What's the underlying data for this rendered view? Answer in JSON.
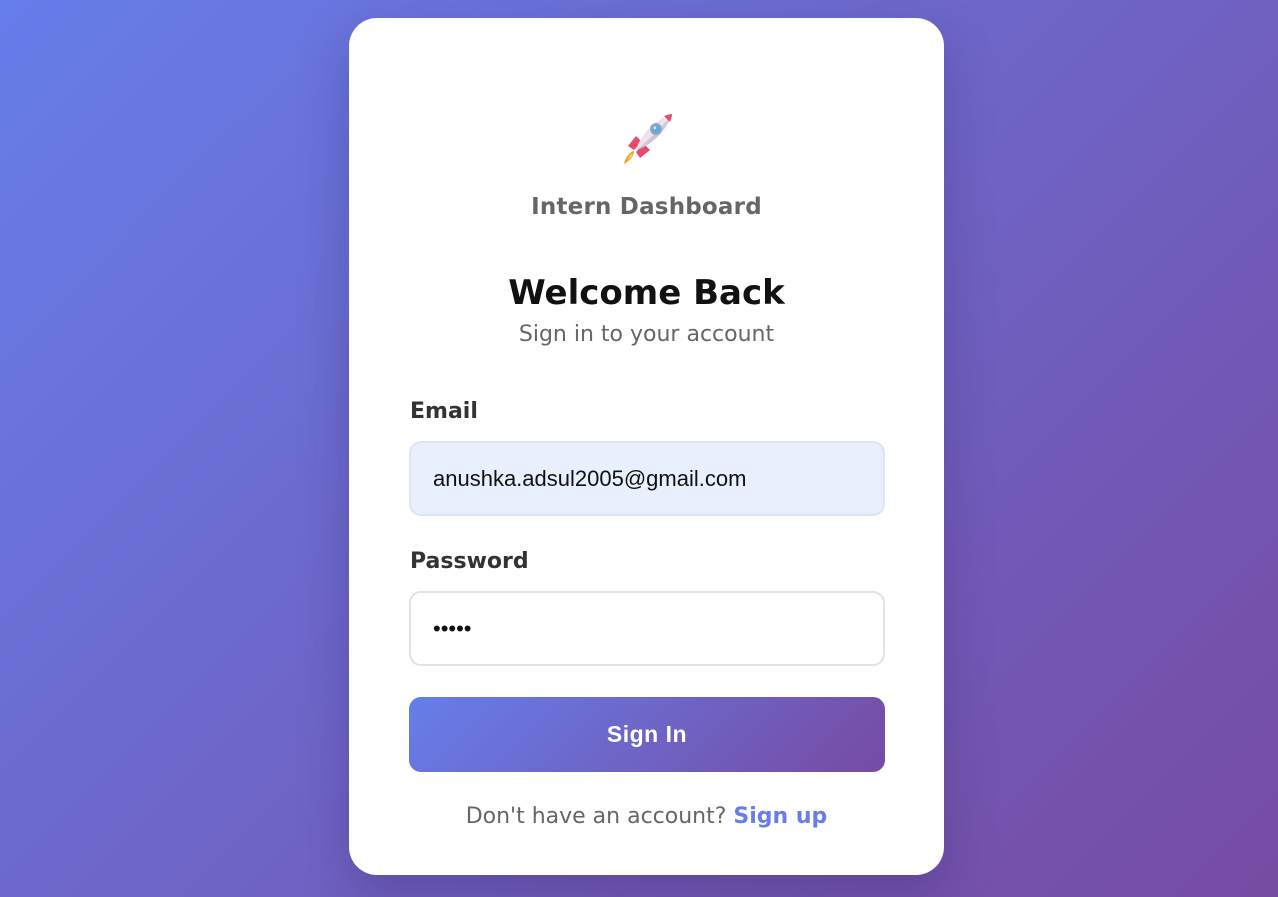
{
  "app": {
    "brand": "Intern Dashboard",
    "logo_icon": "rocket-icon"
  },
  "form": {
    "title": "Welcome Back",
    "subtitle": "Sign in to your account",
    "email_label": "Email",
    "email_value": "anushka.adsul2005@gmail.com",
    "password_label": "Password",
    "password_value": "•••••",
    "submit_label": "Sign In"
  },
  "footer": {
    "prompt": "Don't have an account?",
    "link_label": "Sign up"
  },
  "colors": {
    "gradient_start": "#667eea",
    "gradient_end": "#764ba2",
    "card_bg": "#ffffff",
    "email_field_bg": "#e8f0fe"
  }
}
